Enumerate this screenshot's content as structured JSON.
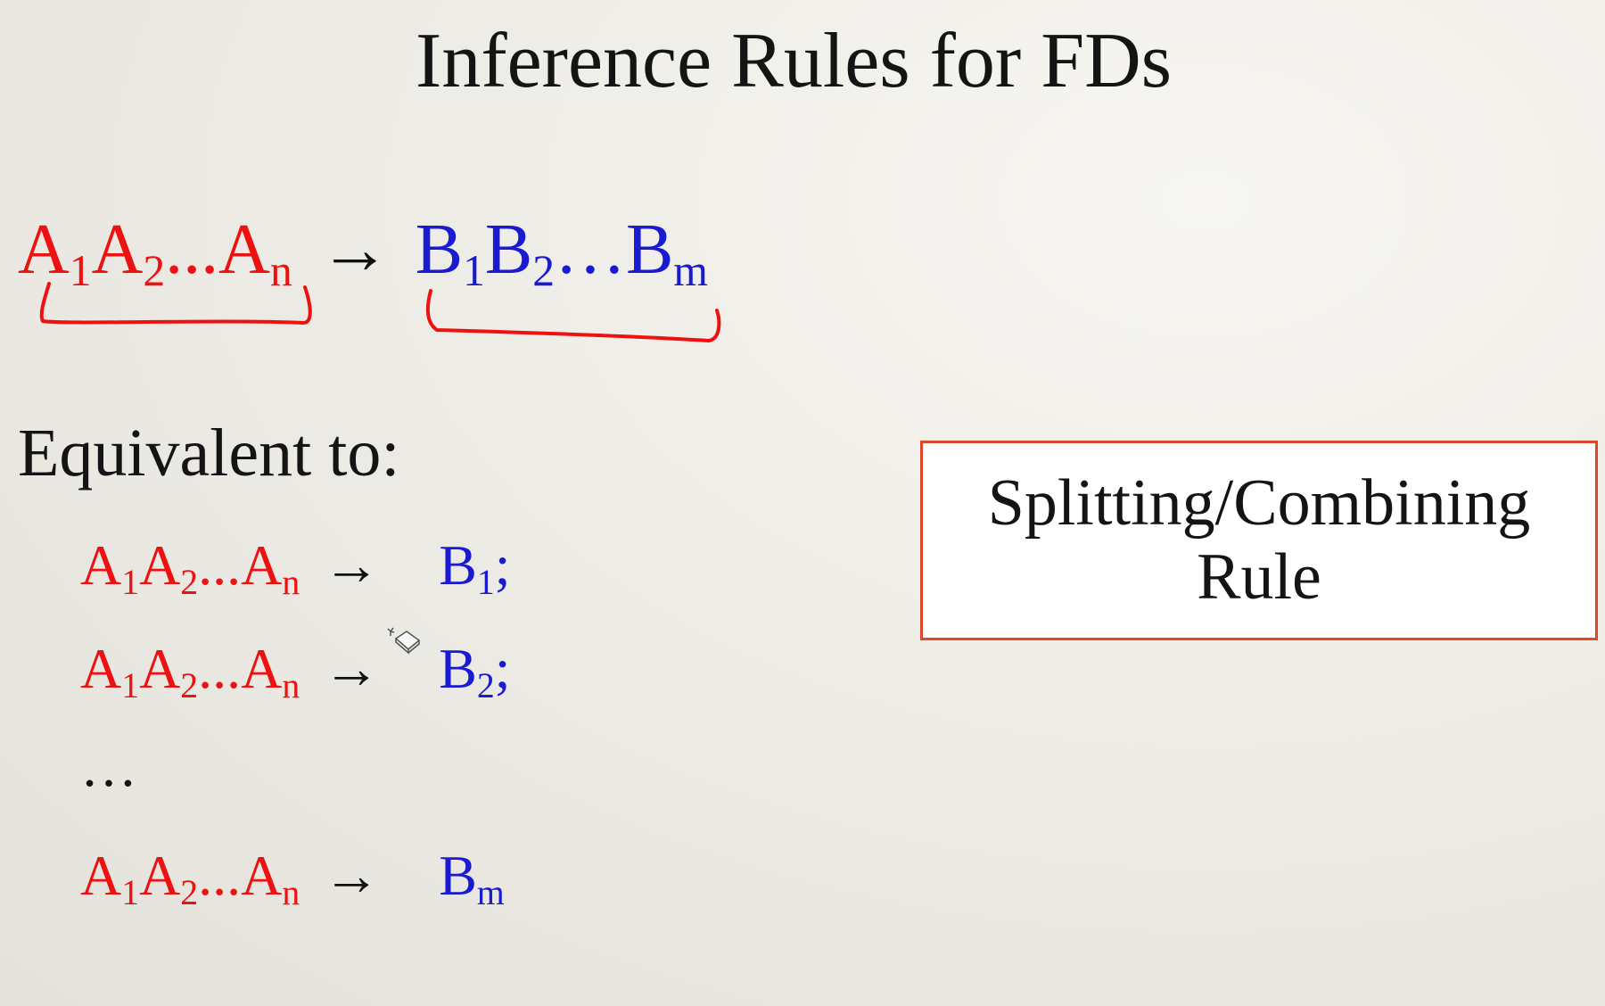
{
  "slide": {
    "title": "Inference Rules for FDs"
  },
  "main_fd": {
    "lhs": {
      "A1": "A",
      "s1": "1",
      "A2": "A",
      "s2": "2",
      "dots": "...",
      "An": "A",
      "sn": "n"
    },
    "arrow": "→",
    "rhs": {
      "B1": "B",
      "s1": "1",
      "B2": "B",
      "s2": "2",
      "dots": "…",
      "Bm": "B",
      "sm": "m"
    }
  },
  "equivalent_label": "Equivalent to:",
  "rows": [
    {
      "lhs": {
        "A1": "A",
        "s1": "1",
        "A2": "A",
        "s2": "2",
        "dots": "...",
        "An": "A",
        "sn": "n"
      },
      "arrow": "→",
      "rhs": "B",
      "rhs_sub": "1",
      "punct": ";"
    },
    {
      "lhs": {
        "A1": "A",
        "s1": "1",
        "A2": "A",
        "s2": "2",
        "dots": "...",
        "An": "A",
        "sn": "n"
      },
      "arrow": "→",
      "rhs": "B",
      "rhs_sub": "2",
      "punct": ";"
    },
    {
      "lhs": {
        "A1": "A",
        "s1": "1",
        "A2": "A",
        "s2": "2",
        "dots": "...",
        "An": "A",
        "sn": "n"
      },
      "arrow": "→",
      "rhs": "B",
      "rhs_sub": "m",
      "punct": ""
    }
  ],
  "ellipsis": "…",
  "rule_box": {
    "text": "Splitting/Combining\nRule"
  },
  "colors": {
    "attribute_red": "#ee1111",
    "attribute_blue": "#1a1ad0",
    "box_border": "#e0462a"
  },
  "icons": {
    "cursor": "eraser-cursor-icon"
  }
}
